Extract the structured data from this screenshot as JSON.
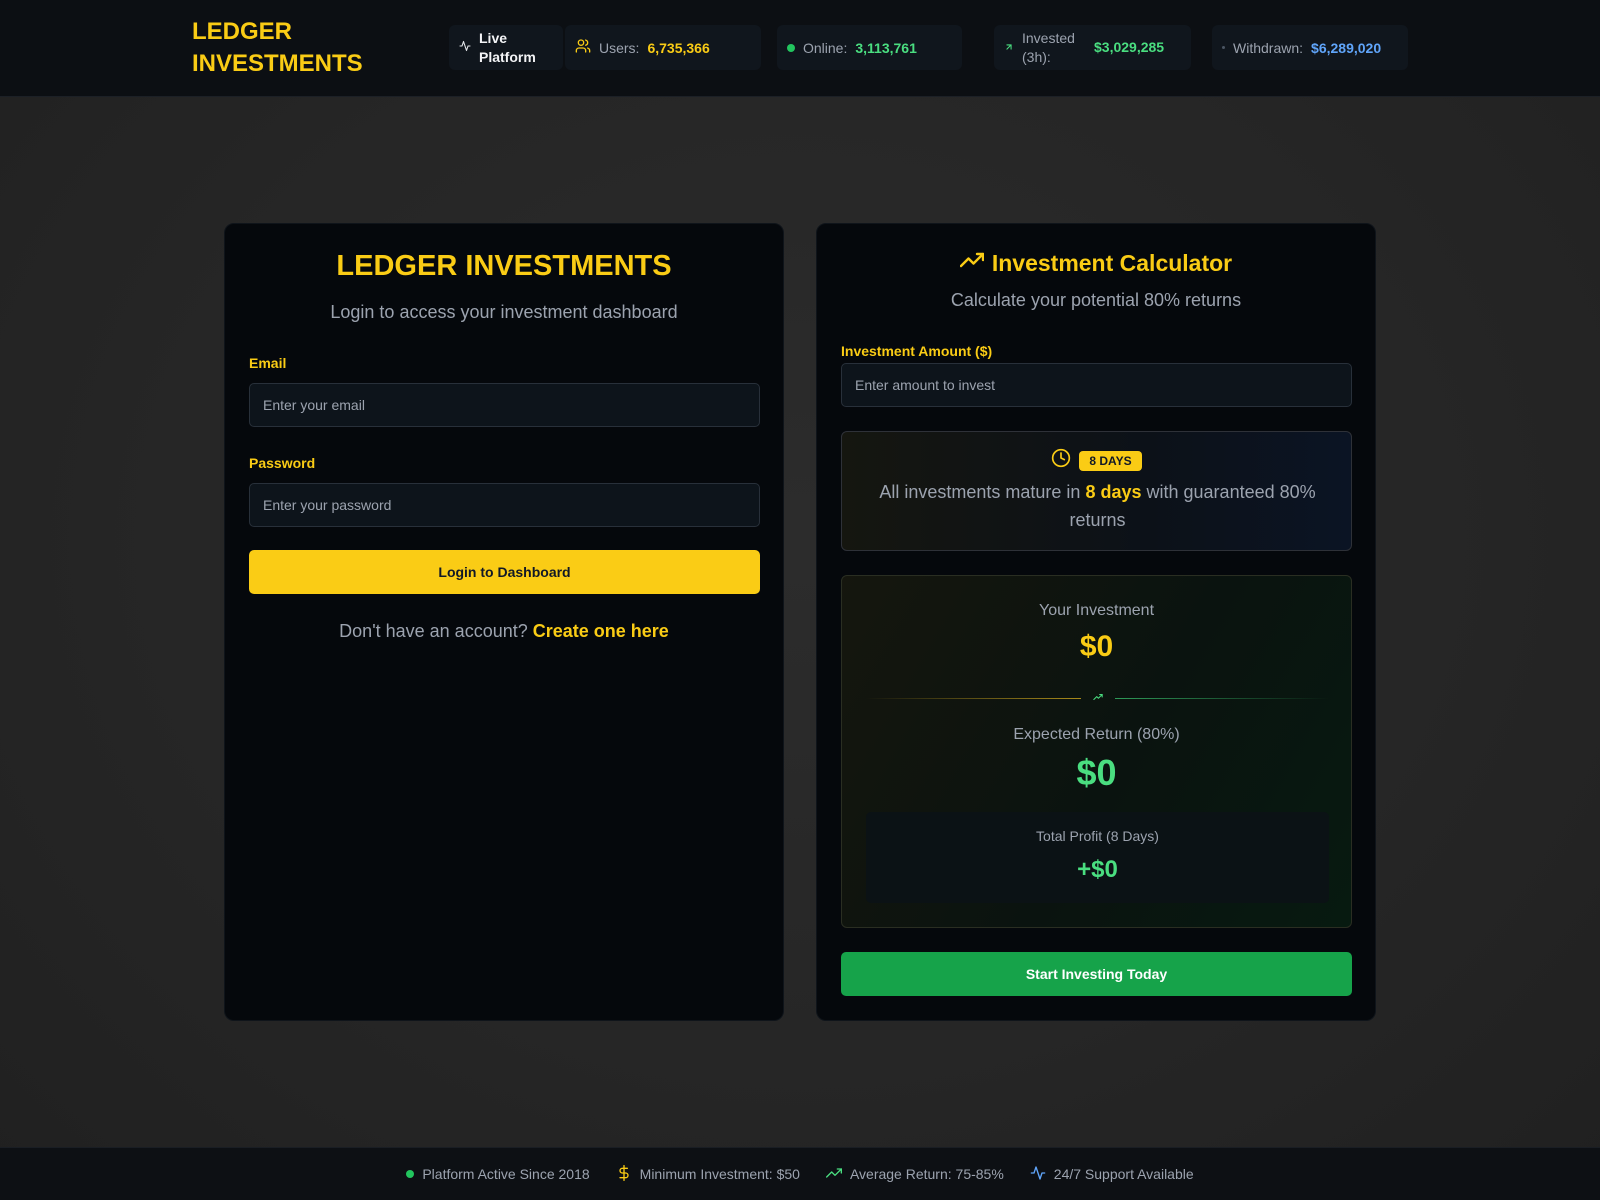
{
  "header": {
    "brand_line1": "LEDGER",
    "brand_line2": "INVESTMENTS",
    "live_line1": "Live",
    "live_line2": "Platform",
    "users_label": "Users:",
    "users_value": "6,735,366",
    "online_label": "Online:",
    "online_value": "3,113,761",
    "invested_line1": "Invested",
    "invested_line2": "(3h):",
    "invested_value": "$3,029,285",
    "withdrawn_label": "Withdrawn:",
    "withdrawn_value": "$6,289,020",
    "icons": [
      "activity-icon",
      "users-icon",
      "status-dot-icon",
      "arrow-up-right-icon",
      "dot-icon"
    ]
  },
  "login": {
    "title": "LEDGER INVESTMENTS",
    "subtitle": "Login to access your investment dashboard",
    "email_label": "Email",
    "email_placeholder": "Enter your email",
    "password_label": "Password",
    "password_placeholder": "Enter your password",
    "submit_label": "Login to Dashboard",
    "signup_prompt": "Don't have an account?",
    "signup_link": "Create one here"
  },
  "calculator": {
    "title": "Investment Calculator",
    "subtitle": "Calculate your potential 80% returns",
    "amount_label": "Investment Amount ($)",
    "amount_placeholder": "Enter amount to invest",
    "maturity_badge": "8 DAYS",
    "maturity_prefix": "All investments mature in",
    "maturity_highlight": "8 days",
    "maturity_suffix": "with guaranteed 80% returns",
    "your_investment_label": "Your Investment",
    "your_investment_value": "$0",
    "expected_return_label": "Expected Return (80%)",
    "expected_return_value": "$0",
    "profit_label": "Total Profit (8 Days)",
    "profit_value": "+$0",
    "cta_label": "Start Investing Today",
    "icons": [
      "trending-up-icon",
      "clock-icon",
      "arrow-up-right-icon"
    ]
  },
  "footer": {
    "items": [
      {
        "label": "Platform Active Since 2018",
        "icon": "status-dot-icon"
      },
      {
        "label": "Minimum Investment: $50",
        "icon": "dollar-icon"
      },
      {
        "label": "Average Return: 75-85%",
        "icon": "trending-up-icon"
      },
      {
        "label": "24/7 Support Available",
        "icon": "activity-icon"
      }
    ]
  },
  "colors": {
    "accent_yellow": "#facc15",
    "accent_green": "#4ade80",
    "accent_blue": "#60a5fa",
    "button_green": "#16a34a",
    "card_bg": "#05080c",
    "topbar_bg": "#0c0f13"
  }
}
